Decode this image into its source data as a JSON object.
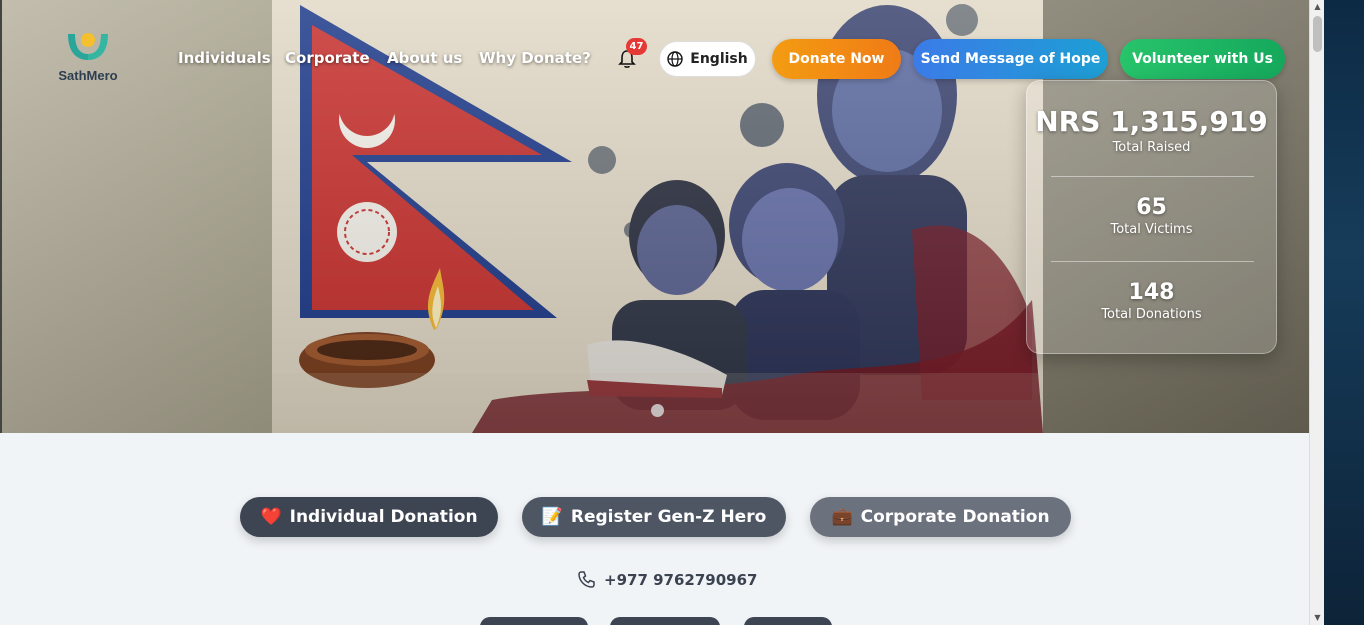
{
  "brand": {
    "name": "SathMero"
  },
  "nav": {
    "links": [
      "Individuals",
      "Corporate",
      "About us",
      "Why Donate?"
    ],
    "notification_count": "47",
    "language": "English",
    "donate_now": "Donate Now",
    "send_message": "Send Message of Hope",
    "volunteer": "Volunteer with Us"
  },
  "stats": [
    {
      "value": "NRS 1,315,919",
      "label": "Total Raised"
    },
    {
      "value": "65",
      "label": "Total Victims"
    },
    {
      "value": "148",
      "label": "Total Donations"
    }
  ],
  "actions": [
    {
      "emoji": "❤️",
      "label": "Individual Donation"
    },
    {
      "emoji": "📝",
      "label": "Register Gen-Z Hero"
    },
    {
      "emoji": "💼",
      "label": "Corporate Donation"
    }
  ],
  "contact": {
    "phone": "+977 9762790967"
  },
  "colors": {
    "donate": "#f39c12",
    "message": "#3b7be8",
    "volunteer": "#27c46b",
    "badge": "#e53935"
  },
  "icons": [
    "bell-icon",
    "globe-icon",
    "phone-icon",
    "logo-icon"
  ]
}
